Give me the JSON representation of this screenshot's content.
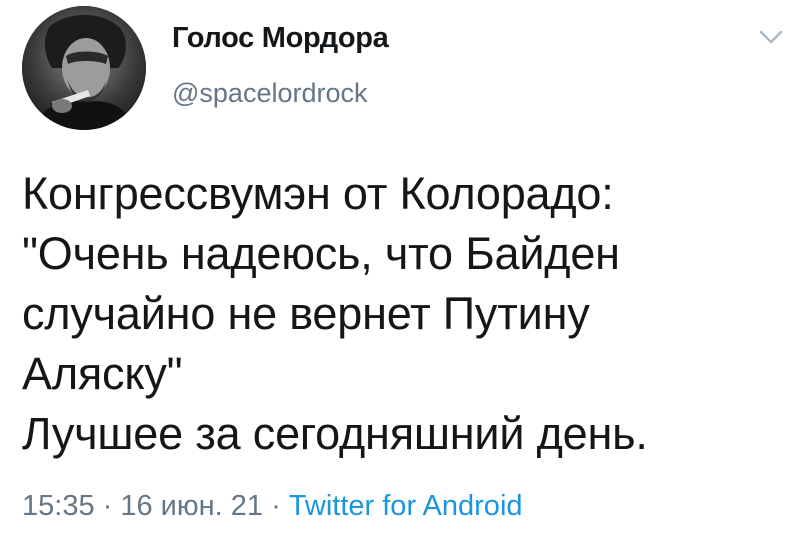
{
  "user": {
    "name": "Голос Мордора",
    "handle": "@spacelordrock"
  },
  "tweet": {
    "lines": [
      "Конгрессвумэн от Колорадо:",
      "\"Очень надеюсь, что Байден",
      "случайно не вернет Путину",
      "Аляску\"",
      "Лучшее за сегодняшний день."
    ]
  },
  "meta": {
    "time": "15:35",
    "separator": " · ",
    "date": "16 июн. 21",
    "source": "Twitter for Android"
  },
  "icons": {
    "menu": "chevron-down-icon",
    "avatar": "avatar"
  },
  "colors": {
    "text": "#14171a",
    "secondary": "#657786",
    "link": "#1b95e0",
    "background": "#ffffff"
  }
}
